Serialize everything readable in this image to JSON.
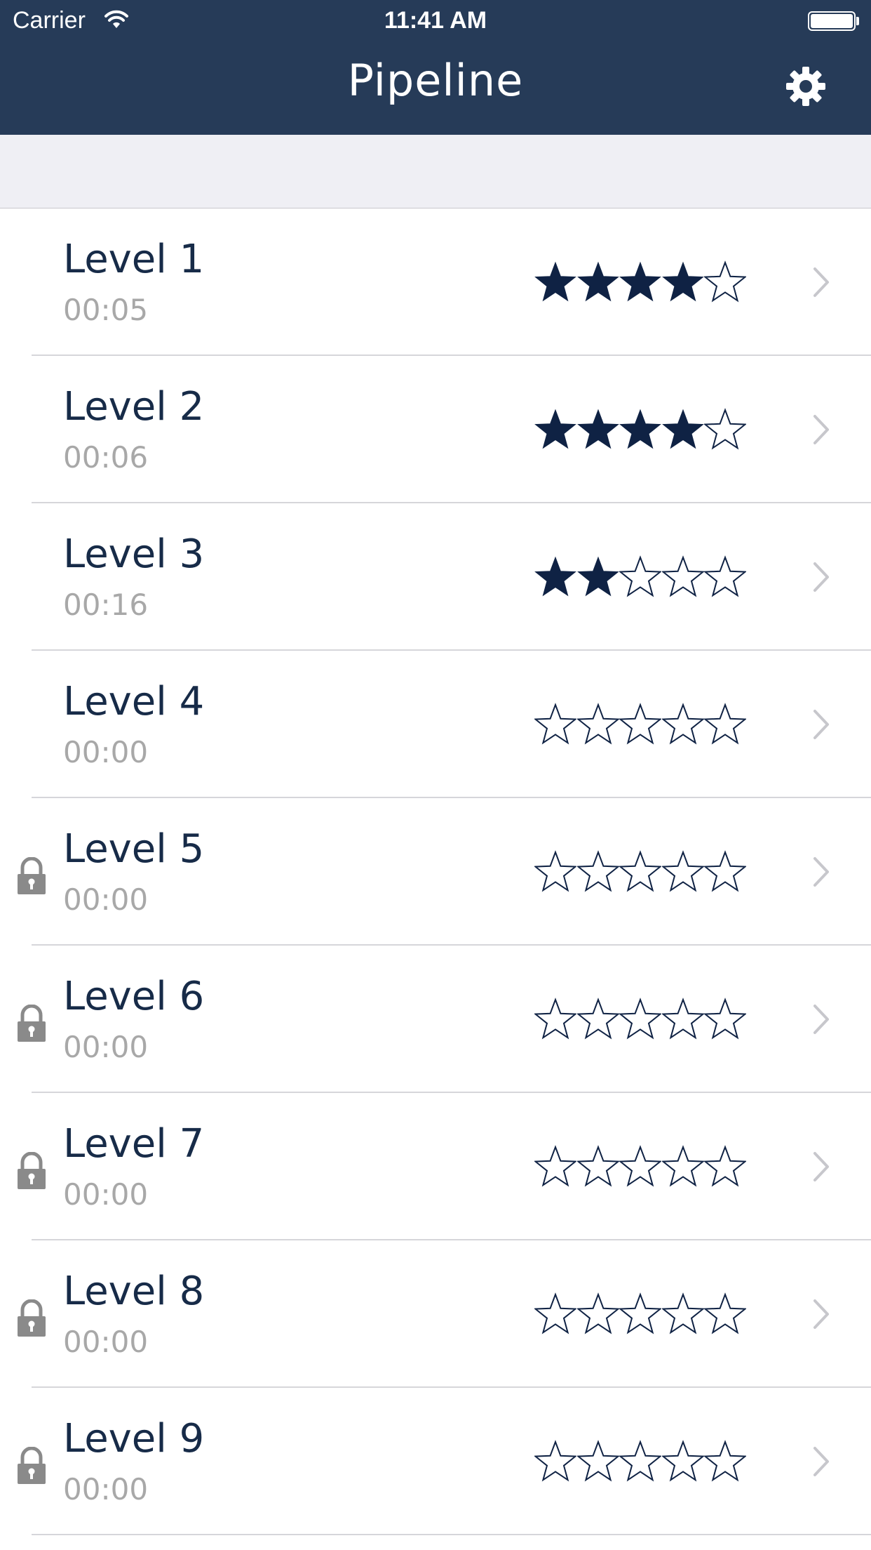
{
  "status_bar": {
    "carrier": "Carrier",
    "time": "11:41 AM",
    "battery_level": 1.0
  },
  "nav": {
    "title": "Pipeline",
    "settings_icon": "gear-icon"
  },
  "colors": {
    "nav_background": "#263b58",
    "star_fill": "#0f2244",
    "level_name": "#172b48",
    "level_time": "#a8a8a8",
    "lock_icon": "#8a8a8a",
    "chevron": "#c7c7cc"
  },
  "levels": [
    {
      "name": "Level 1",
      "time": "00:05",
      "stars": 4,
      "max_stars": 5,
      "locked": false
    },
    {
      "name": "Level 2",
      "time": "00:06",
      "stars": 4,
      "max_stars": 5,
      "locked": false
    },
    {
      "name": "Level 3",
      "time": "00:16",
      "stars": 2,
      "max_stars": 5,
      "locked": false
    },
    {
      "name": "Level 4",
      "time": "00:00",
      "stars": 0,
      "max_stars": 5,
      "locked": false
    },
    {
      "name": "Level 5",
      "time": "00:00",
      "stars": 0,
      "max_stars": 5,
      "locked": true
    },
    {
      "name": "Level 6",
      "time": "00:00",
      "stars": 0,
      "max_stars": 5,
      "locked": true
    },
    {
      "name": "Level 7",
      "time": "00:00",
      "stars": 0,
      "max_stars": 5,
      "locked": true
    },
    {
      "name": "Level 8",
      "time": "00:00",
      "stars": 0,
      "max_stars": 5,
      "locked": true
    },
    {
      "name": "Level 9",
      "time": "00:00",
      "stars": 0,
      "max_stars": 5,
      "locked": true
    }
  ]
}
